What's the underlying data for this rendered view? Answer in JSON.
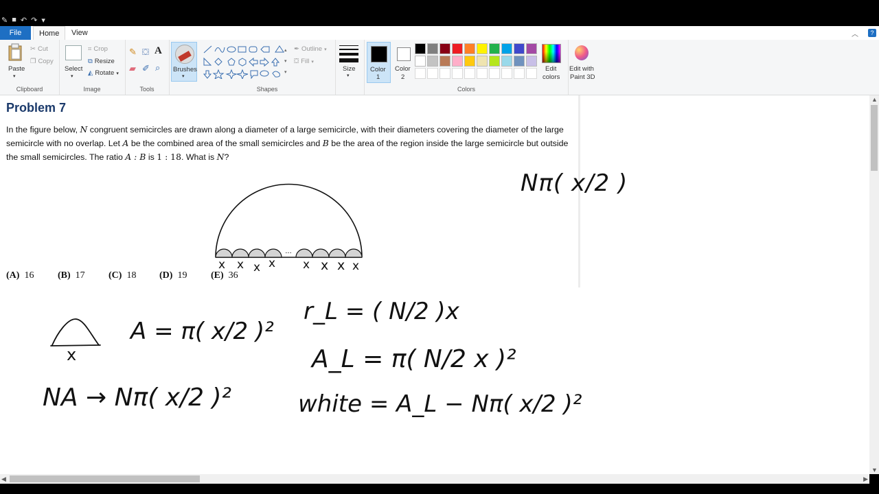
{
  "ribbon": {
    "tabs": {
      "file": "File",
      "home": "Home",
      "view": "View"
    },
    "clipboard": {
      "paste": "Paste",
      "cut": "Cut",
      "copy": "Copy",
      "label": "Clipboard"
    },
    "image": {
      "select": "Select",
      "crop": "Crop",
      "resize": "Resize",
      "rotate": "Rotate",
      "label": "Image"
    },
    "tools": {
      "label": "Tools"
    },
    "brushes": {
      "label": "Brushes"
    },
    "shapes": {
      "outline": "Outline",
      "fill": "Fill",
      "label": "Shapes"
    },
    "size": {
      "label": "Size"
    },
    "color1": {
      "label": "Color",
      "num": "1",
      "value": "#000000"
    },
    "color2": {
      "label": "Color",
      "num": "2",
      "value": "#ffffff"
    },
    "colors": {
      "label": "Colors",
      "row1": [
        "#000000",
        "#7f7f7f",
        "#880015",
        "#ed1c24",
        "#ff7f27",
        "#fff200",
        "#22b14c",
        "#00a2e8",
        "#3f48cc",
        "#a349a4"
      ],
      "row2": [
        "#ffffff",
        "#c3c3c3",
        "#b97a57",
        "#ffaec9",
        "#ffc90e",
        "#efe4b0",
        "#b5e61d",
        "#99d9ea",
        "#7092be",
        "#c8bfe7"
      ],
      "row3": [
        "#ffffff",
        "#ffffff",
        "#ffffff",
        "#ffffff",
        "#ffffff",
        "#ffffff",
        "#ffffff",
        "#ffffff",
        "#ffffff",
        "#ffffff"
      ]
    },
    "edit_colors": {
      "line1": "Edit",
      "line2": "colors"
    },
    "paint3d": {
      "line1": "Edit with",
      "line2": "Paint 3D"
    }
  },
  "problem": {
    "title": "Problem 7",
    "text_parts": {
      "p1": "In the figure below, ",
      "N": "N",
      "p2": " congruent semicircles are drawn along a diameter of a large semicircle, with their diameters covering the diameter of the large semicircle with no overlap. Let ",
      "A": "A",
      "p3": " be the combined area of the small semicircles and ",
      "B": "B",
      "p4": " be the area of the region inside the large semicircle but outside the small semicircles. The ratio ",
      "ratio": "A : B",
      "p5": " is ",
      "ratio_val": "1 : 18",
      "p6": ". What is ",
      "N2": "N",
      "p7": "?"
    },
    "figure_dots": "···",
    "answers": [
      {
        "letter": "(A)",
        "value": "16"
      },
      {
        "letter": "(B)",
        "value": "17"
      },
      {
        "letter": "(C)",
        "value": "18"
      },
      {
        "letter": "(D)",
        "value": "19"
      },
      {
        "letter": "(E)",
        "value": "36"
      }
    ]
  },
  "handwriting": {
    "fig_labels": [
      "x",
      "x",
      "x",
      "x",
      "x",
      "x",
      "x",
      "x"
    ],
    "top_right": "Nπ( x/2 )",
    "small_x": "x",
    "eq_A": "A = π( x/2 )²",
    "eq_NA": "NA → Nπ( x/2 )²",
    "eq_rL": "r_L = ( N/2 )x",
    "eq_AL": "A_L = π( N/2 x )²",
    "eq_white": "white = A_L − Nπ( x/2 )²"
  }
}
